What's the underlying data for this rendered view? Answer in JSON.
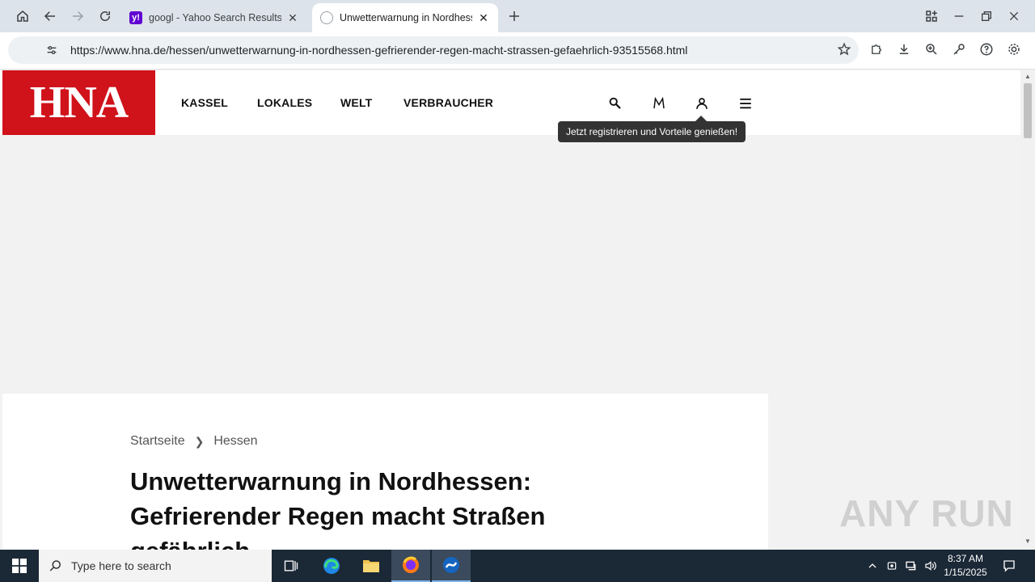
{
  "browser": {
    "tabs": [
      {
        "title": "googl - Yahoo Search Results",
        "favicon": "yahoo-icon",
        "active": false
      },
      {
        "title": "Unwetterwarnung in Nordhessen: Gefrierender Regen macht Straßen gefährlich",
        "favicon": "globe-icon",
        "active": true
      }
    ],
    "url": "https://www.hna.de/hessen/unwetterwarnung-in-nordhessen-gefrierender-regen-macht-strassen-gefaehrlich-93515568.html"
  },
  "site": {
    "logo": "HNA",
    "brand_color": "#d0121b",
    "nav": [
      "KASSEL",
      "LOKALES",
      "WELT",
      "VERBRAUCHER"
    ],
    "header_icons": [
      "search-icon",
      "merkur-m-icon",
      "user-icon",
      "menu-icon"
    ],
    "tooltip": "Jetzt registrieren und Vorteile genießen!"
  },
  "article": {
    "breadcrumb": [
      "Startseite",
      "Hessen"
    ],
    "headline": "Unwetterwarnung in Nordhessen: Gefrierender Regen macht Straßen gefährlich"
  },
  "watermark": "ANY RUN",
  "taskbar": {
    "search_placeholder": "Type here to search",
    "apps": [
      "task-view-icon",
      "edge-icon",
      "file-explorer-icon",
      "firefox-icon",
      "app-icon"
    ],
    "time": "8:37 AM",
    "date": "1/15/2025"
  }
}
